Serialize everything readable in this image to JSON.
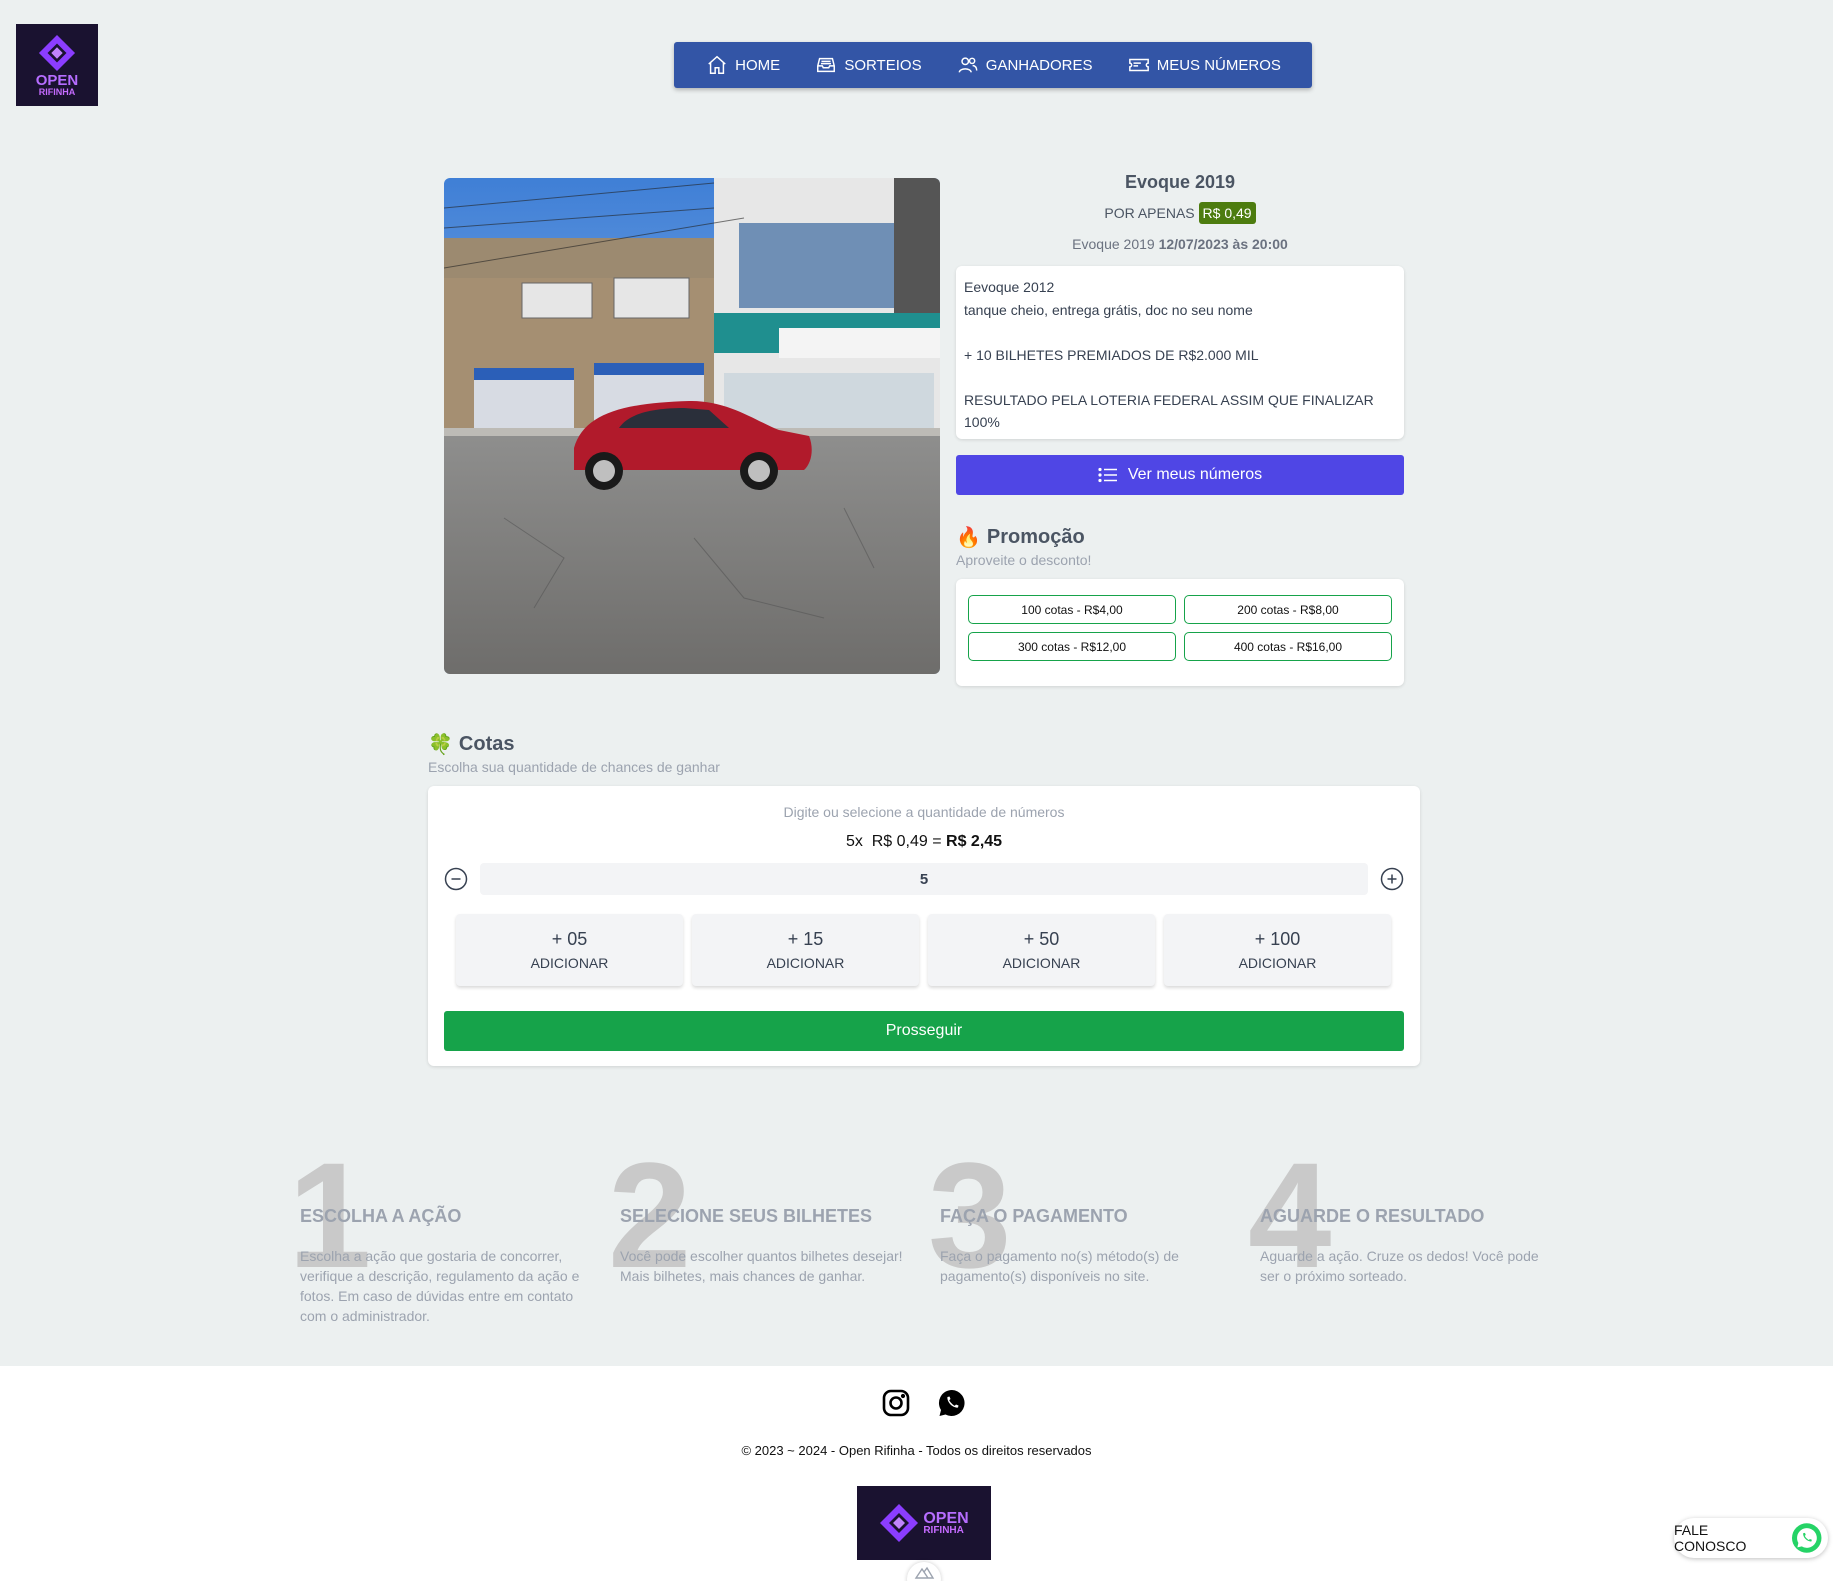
{
  "brand": {
    "name": "OPEN",
    "sub": "RIFINHA"
  },
  "nav": {
    "items": [
      {
        "label": "HOME",
        "icon": "home-icon"
      },
      {
        "label": "SORTEIOS",
        "icon": "inbox-icon"
      },
      {
        "label": "GANHADORES",
        "icon": "users-icon"
      },
      {
        "label": "MEUS NÚMEROS",
        "icon": "ticket-icon"
      }
    ]
  },
  "raffle": {
    "title": "Evoque 2019",
    "price_prefix": "POR APENAS",
    "price": "R$ 0,49",
    "date_prefix": "Evoque 2019",
    "date": "12/07/2023 às 20:00",
    "description": [
      "Eevoque 2012",
      "tanque cheio, entrega grátis, doc no seu nome",
      "",
      "+ 10 BILHETES PREMIADOS DE R$2.000 MIL",
      "",
      "RESULTADO PELA LOTERIA FEDERAL ASSIM QUE FINALIZAR 100%"
    ],
    "view_numbers_label": "Ver meus números"
  },
  "promo": {
    "title": "Promoção",
    "subtitle": "Aproveite o desconto!",
    "options": [
      "100 cotas - R$4,00",
      "200 cotas - R$8,00",
      "300 cotas - R$12,00",
      "400 cotas - R$16,00"
    ]
  },
  "cotas": {
    "title": "Cotas",
    "subtitle": "Escolha sua quantidade de chances de ganhar",
    "hint": "Digite ou selecione a quantidade de números",
    "calc_qty": "5x",
    "calc_unit": "R$ 0,49 =",
    "calc_total": "R$ 2,45",
    "quantity": "5",
    "add_options": [
      {
        "amount": "+ 05",
        "label": "ADICIONAR"
      },
      {
        "amount": "+ 15",
        "label": "ADICIONAR"
      },
      {
        "amount": "+ 50",
        "label": "ADICIONAR"
      },
      {
        "amount": "+ 100",
        "label": "ADICIONAR"
      }
    ],
    "proceed_label": "Prosseguir"
  },
  "steps": [
    {
      "num": "1",
      "title": "ESCOLHA A AÇÃO",
      "text": "Escolha a ação que gostaria de concorrer, verifique a descrição, regulamento da ação e fotos. Em caso de dúvidas entre em contato com o administrador."
    },
    {
      "num": "2",
      "title": "SELECIONE SEUS BILHETES",
      "text": "Você pode escolher quantos bilhetes desejar! Mais bilhetes, mais chances de ganhar."
    },
    {
      "num": "3",
      "title": "FAÇA O PAGAMENTO",
      "text": "Faça o pagamento no(s) método(s) de pagamento(s) disponíveis no site."
    },
    {
      "num": "4",
      "title": "AGUARDE O RESULTADO",
      "text": "Aguarde a ação. Cruze os dedos! Você pode ser o próximo sorteado."
    }
  ],
  "footer": {
    "copyright": "© 2023 ~ 2024 - Open Rifinha - Todos os direitos reservados",
    "contact_label": "FALE CONOSCO"
  },
  "colors": {
    "nav_bg": "#3355a6",
    "primary_button": "#4f46e5",
    "success": "#16a34a",
    "price_badge": "#4d7c0f",
    "logo_bg": "#1a1230"
  }
}
